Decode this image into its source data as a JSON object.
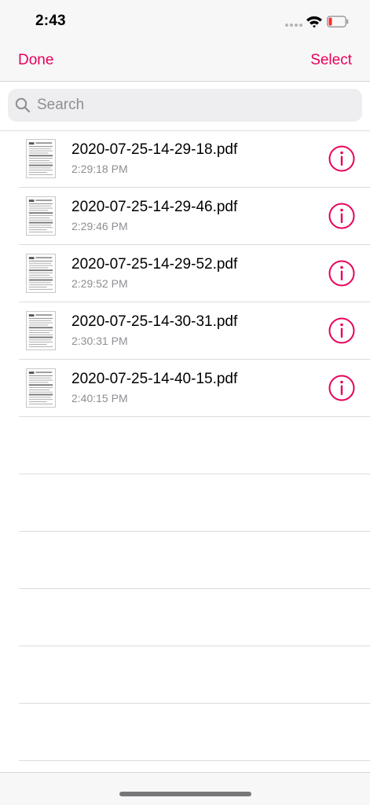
{
  "status_bar": {
    "time": "2:43"
  },
  "nav": {
    "done_label": "Done",
    "select_label": "Select"
  },
  "search": {
    "placeholder": "Search"
  },
  "files": [
    {
      "name": "2020-07-25-14-29-18.pdf",
      "time": "2:29:18 PM"
    },
    {
      "name": "2020-07-25-14-29-46.pdf",
      "time": "2:29:46 PM"
    },
    {
      "name": "2020-07-25-14-29-52.pdf",
      "time": "2:29:52 PM"
    },
    {
      "name": "2020-07-25-14-30-31.pdf",
      "time": "2:30:31 PM"
    },
    {
      "name": "2020-07-25-14-40-15.pdf",
      "time": "2:40:15 PM"
    }
  ],
  "colors": {
    "accent": "#e8005a",
    "secondary_text": "#8e8e93",
    "separator": "#dcdcde"
  }
}
